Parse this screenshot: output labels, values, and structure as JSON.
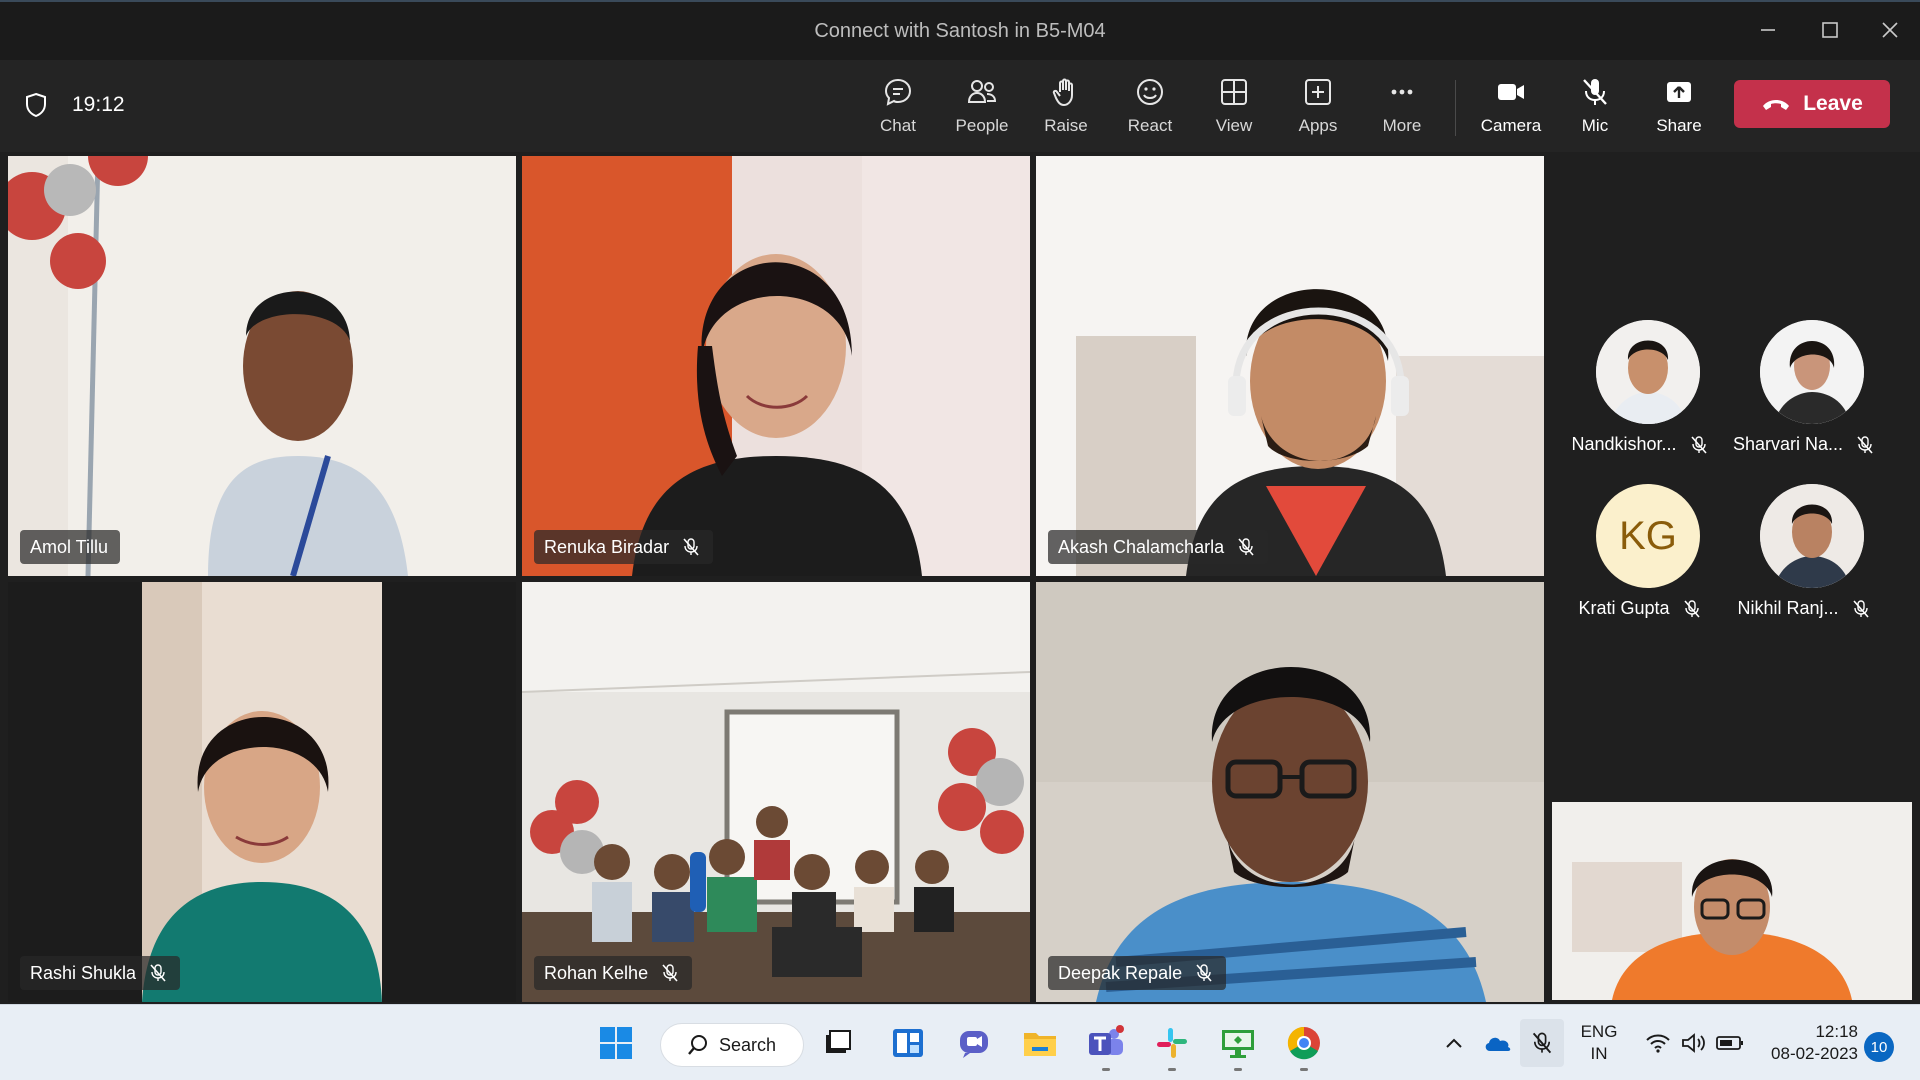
{
  "window": {
    "title": "Connect with Santosh in B5-M04",
    "controls": [
      "minimize-icon",
      "maximize-icon",
      "close-icon"
    ]
  },
  "toolbar": {
    "timer": "19:12",
    "buttons": [
      {
        "label": "Chat",
        "icon": "chat-icon"
      },
      {
        "label": "People",
        "icon": "people-icon"
      },
      {
        "label": "Raise",
        "icon": "raise-hand-icon"
      },
      {
        "label": "React",
        "icon": "react-icon"
      },
      {
        "label": "View",
        "icon": "view-icon"
      },
      {
        "label": "Apps",
        "icon": "apps-icon"
      },
      {
        "label": "More",
        "icon": "more-icon"
      },
      {
        "label": "Camera",
        "icon": "camera-icon"
      },
      {
        "label": "Mic",
        "icon": "mic-off-icon"
      },
      {
        "label": "Share",
        "icon": "share-icon"
      }
    ],
    "leave_label": "Leave",
    "leave_color": "#c4314b"
  },
  "participants": [
    {
      "name": "Amol Tillu",
      "muted": false
    },
    {
      "name": "Renuka Biradar",
      "muted": true
    },
    {
      "name": "Akash Chalamcharla",
      "muted": true
    },
    {
      "name": "Rashi Shukla",
      "muted": true
    },
    {
      "name": "Rohan Kelhe",
      "muted": true
    },
    {
      "name": "Deepak Repale",
      "muted": true
    }
  ],
  "roster": [
    {
      "name": "Nandkishor...",
      "muted": true
    },
    {
      "name": "Sharvari Na...",
      "muted": true
    },
    {
      "name": "Krati Gupta",
      "initials": "KG",
      "muted": true
    },
    {
      "name": "Nikhil Ranj...",
      "muted": true
    }
  ],
  "taskbar": {
    "search_label": "Search",
    "language": "ENG",
    "region": "IN",
    "time": "12:18",
    "date": "08-02-2023",
    "notifications": "10"
  }
}
